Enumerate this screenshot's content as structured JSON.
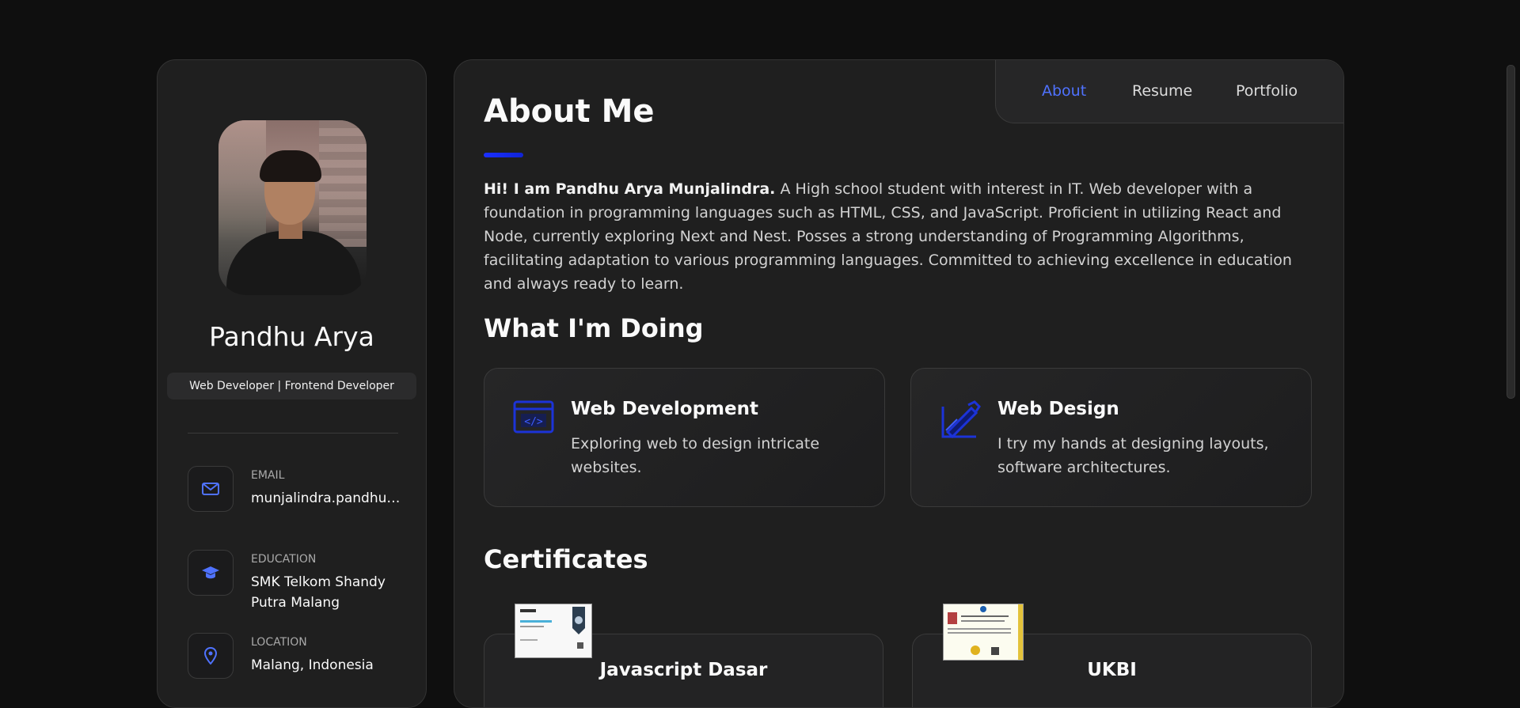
{
  "profile": {
    "name": "Pandhu Arya",
    "role": "Web Developer | Frontend Developer",
    "contacts": [
      {
        "label": "Email",
        "value": "munjalindra.pandhu@gmail.com",
        "icon": "mail-icon"
      },
      {
        "label": "Education",
        "value": "SMK Telkom Shandy Putra Malang",
        "icon": "graduation-cap-icon"
      },
      {
        "label": "Location",
        "value": "Malang, Indonesia",
        "icon": "location-pin-icon"
      }
    ]
  },
  "nav": {
    "items": [
      {
        "label": "About",
        "active": true
      },
      {
        "label": "Resume",
        "active": false
      },
      {
        "label": "Portfolio",
        "active": false
      }
    ]
  },
  "about": {
    "heading": "About Me",
    "intro_bold": "Hi! I am Pandhu Arya Munjalindra.",
    "intro_text": " A High school student with interest in IT. Web developer with a foundation in programming languages such as HTML, CSS, and JavaScript. Proficient in utilizing React and Node, currently exploring Next and Nest. Posses a strong understanding of Programming Algorithms, facilitating adaptation to various programming languages. Committed to achieving excellence in education and always ready to learn."
  },
  "doing": {
    "heading": "What I'm Doing",
    "services": [
      {
        "title": "Web Development",
        "desc": "Exploring web to design intricate websites.",
        "icon": "code-window-icon"
      },
      {
        "title": "Web Design",
        "desc": "I try my hands at designing layouts, software architectures.",
        "icon": "design-pencil-icon"
      }
    ]
  },
  "certificates": {
    "heading": "Certificates",
    "items": [
      {
        "title": "Javascript Dasar"
      },
      {
        "title": "UKBI"
      }
    ]
  },
  "colors": {
    "accent": "#4f72ff",
    "background": "#0f0f0f",
    "card": "#1f1f1f"
  }
}
